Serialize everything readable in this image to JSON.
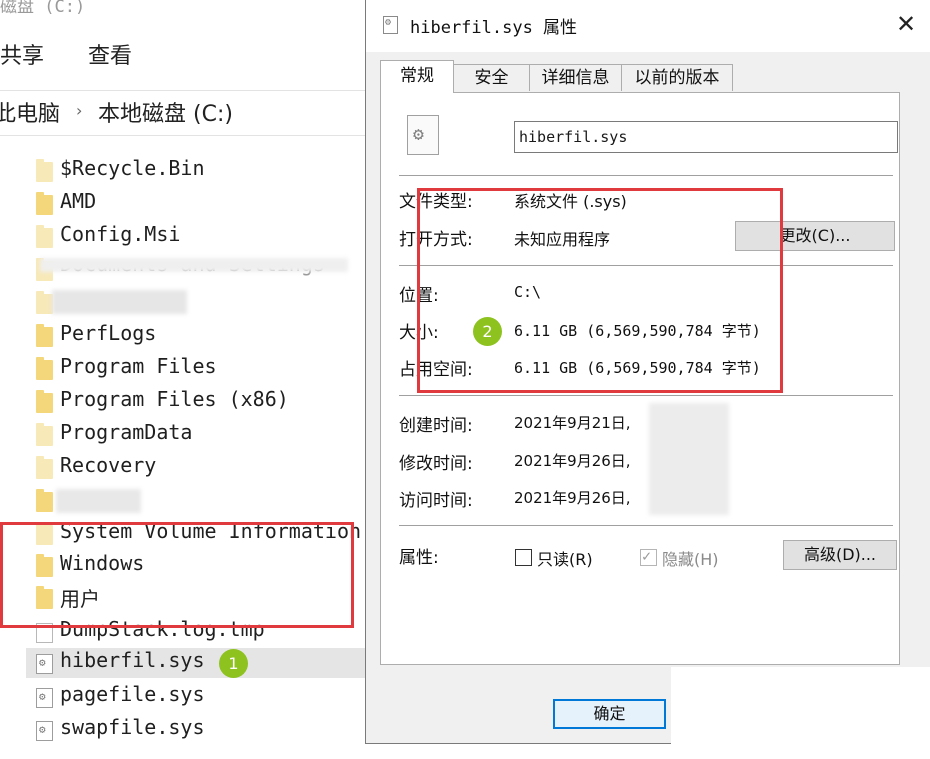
{
  "explorer": {
    "title_fragment": "磁盘 (C:)",
    "ribbon": {
      "share": "共享",
      "view": "查看"
    },
    "breadcrumb": {
      "parent": "此电脑",
      "separator": "›",
      "current": "本地磁盘 (C:)"
    },
    "items": [
      {
        "name": "$Recycle.Bin",
        "type": "folder-pale"
      },
      {
        "name": "AMD",
        "type": "folder"
      },
      {
        "name": "Config.Msi",
        "type": "folder-pale"
      },
      {
        "name": "Documents and Settings",
        "type": "folder-pale"
      },
      {
        "name": "",
        "type": "folder-pale"
      },
      {
        "name": "PerfLogs",
        "type": "folder"
      },
      {
        "name": "Program Files",
        "type": "folder"
      },
      {
        "name": "Program Files (x86)",
        "type": "folder"
      },
      {
        "name": "ProgramData",
        "type": "folder-pale"
      },
      {
        "name": "Recovery",
        "type": "folder-pale"
      },
      {
        "name": "",
        "type": "folder"
      },
      {
        "name": "System Volume Information",
        "type": "folder-pale"
      },
      {
        "name": "Windows",
        "type": "folder"
      },
      {
        "name": "用户",
        "type": "folder"
      },
      {
        "name": "DumpStack.log.tmp",
        "type": "file"
      },
      {
        "name": "hiberfil.sys",
        "type": "sysfile",
        "selected": true
      },
      {
        "name": "pagefile.sys",
        "type": "sysfile"
      },
      {
        "name": "swapfile.sys",
        "type": "sysfile"
      }
    ]
  },
  "dialog": {
    "title": "hiberfil.sys 属性",
    "close_symbol": "✕",
    "tabs": [
      "常规",
      "安全",
      "详细信息",
      "以前的版本"
    ],
    "file_name": "hiberfil.sys",
    "file_type_label": "文件类型:",
    "file_type_value": "系统文件 (.sys)",
    "opens_with_label": "打开方式:",
    "opens_with_value": "未知应用程序",
    "change_button": "更改(C)...",
    "location_label": "位置:",
    "location_value": "C:\\",
    "size_label": "大小:",
    "size_value": "6.11 GB (6,569,590,784 字节)",
    "size_on_disk_label": "占用空间:",
    "size_on_disk_value": "6.11 GB (6,569,590,784 字节)",
    "created_label": "创建时间:",
    "created_value": "2021年9月21日,",
    "modified_label": "修改时间:",
    "modified_value": "2021年9月26日,",
    "accessed_label": "访问时间:",
    "accessed_value": "2021年9月26日,",
    "attributes_label": "属性:",
    "readonly_label": "只读(R)",
    "readonly_checked": false,
    "hidden_label": "隐藏(H)",
    "hidden_checked": true,
    "advanced_button": "高级(D)...",
    "ok_button": "确定"
  },
  "annotations": {
    "badge1": "1",
    "badge2": "2"
  },
  "colors": {
    "highlight_box": "#e0393e",
    "badge": "#8dc21f",
    "ok_border": "#0078d7"
  }
}
